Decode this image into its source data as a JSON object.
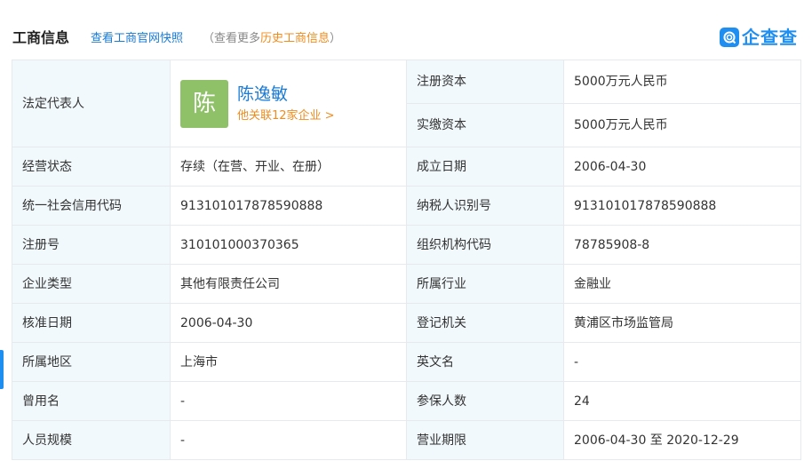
{
  "header": {
    "title": "工商信息",
    "snapshot_link": "查看工商官网快照",
    "history_prefix": "（查看更多",
    "history_link": "历史工商信息",
    "history_suffix": "）",
    "logo_text": "企查查"
  },
  "legal_rep": {
    "label": "法定代表人",
    "avatar_char": "陈",
    "name": "陈逸敏",
    "related": "他关联12家企业 >"
  },
  "capital": [
    {
      "label": "注册资本",
      "value": "5000万元人民币"
    },
    {
      "label": "实缴资本",
      "value": "5000万元人民币"
    }
  ],
  "rows": [
    {
      "l1": "经营状态",
      "v1": "存续（在营、开业、在册）",
      "l2": "成立日期",
      "v2": "2006-04-30"
    },
    {
      "l1": "统一社会信用代码",
      "v1": "913101017878590888",
      "l2": "纳税人识别号",
      "v2": "913101017878590888"
    },
    {
      "l1": "注册号",
      "v1": "310101000370365",
      "l2": "组织机构代码",
      "v2": "78785908-8"
    },
    {
      "l1": "企业类型",
      "v1": "其他有限责任公司",
      "l2": "所属行业",
      "v2": "金融业"
    },
    {
      "l1": "核准日期",
      "v1": "2006-04-30",
      "l2": "登记机关",
      "v2": "黄浦区市场监管局"
    },
    {
      "l1": "所属地区",
      "v1": "上海市",
      "l2": "英文名",
      "v2": "-"
    },
    {
      "l1": "曾用名",
      "v1": "-",
      "l2": "参保人数",
      "v2": "24"
    },
    {
      "l1": "人员规模",
      "v1": "-",
      "l2": "营业期限",
      "v2": "2006-04-30 至 2020-12-29"
    }
  ],
  "colors": {
    "accent": "#1a7bd6",
    "orange": "#f08c1e",
    "avatar_bg": "#8fc168",
    "label_bg": "#f2f9fc",
    "border": "#e6eaee"
  }
}
